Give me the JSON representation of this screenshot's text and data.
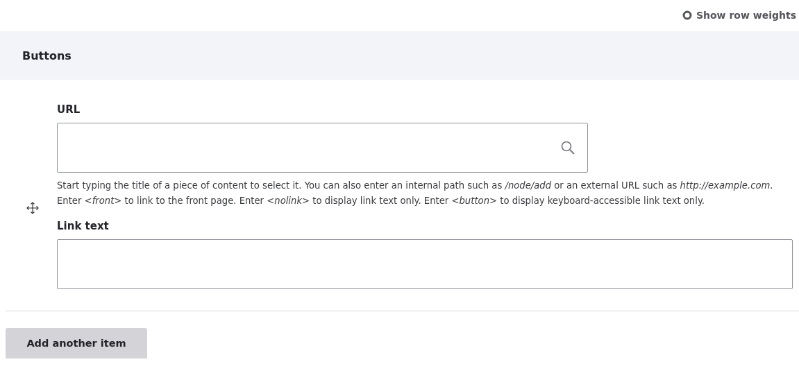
{
  "row_weights_toggle": "Show row weights",
  "section": {
    "title": "Buttons"
  },
  "fields": [
    {
      "label": "URL",
      "kind": "search",
      "description": "Start typing the title of a piece of content to select it. You can also enter an internal path such as */node/add* or an external URL such as *http://example.com*. Enter *<front>* to link to the front page. Enter *<nolink>* to display link text only. Enter *<button>* to display keyboard-accessible link text only."
    },
    {
      "label": "Link text",
      "kind": "text"
    }
  ],
  "add_button": "Add another item"
}
